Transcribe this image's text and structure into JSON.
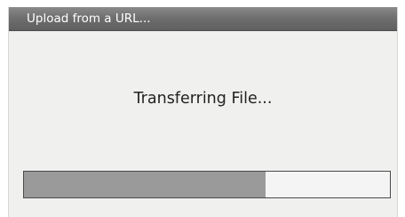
{
  "dialog": {
    "title": "Upload from a URL...",
    "status_text": "Transferring File...",
    "progress_fraction": 0.66,
    "colors": {
      "titlebar": "#6f6f6f",
      "body": "#f0f0ee",
      "progress_fill": "#9a9a9a",
      "progress_track": "#f4f4f4"
    }
  }
}
